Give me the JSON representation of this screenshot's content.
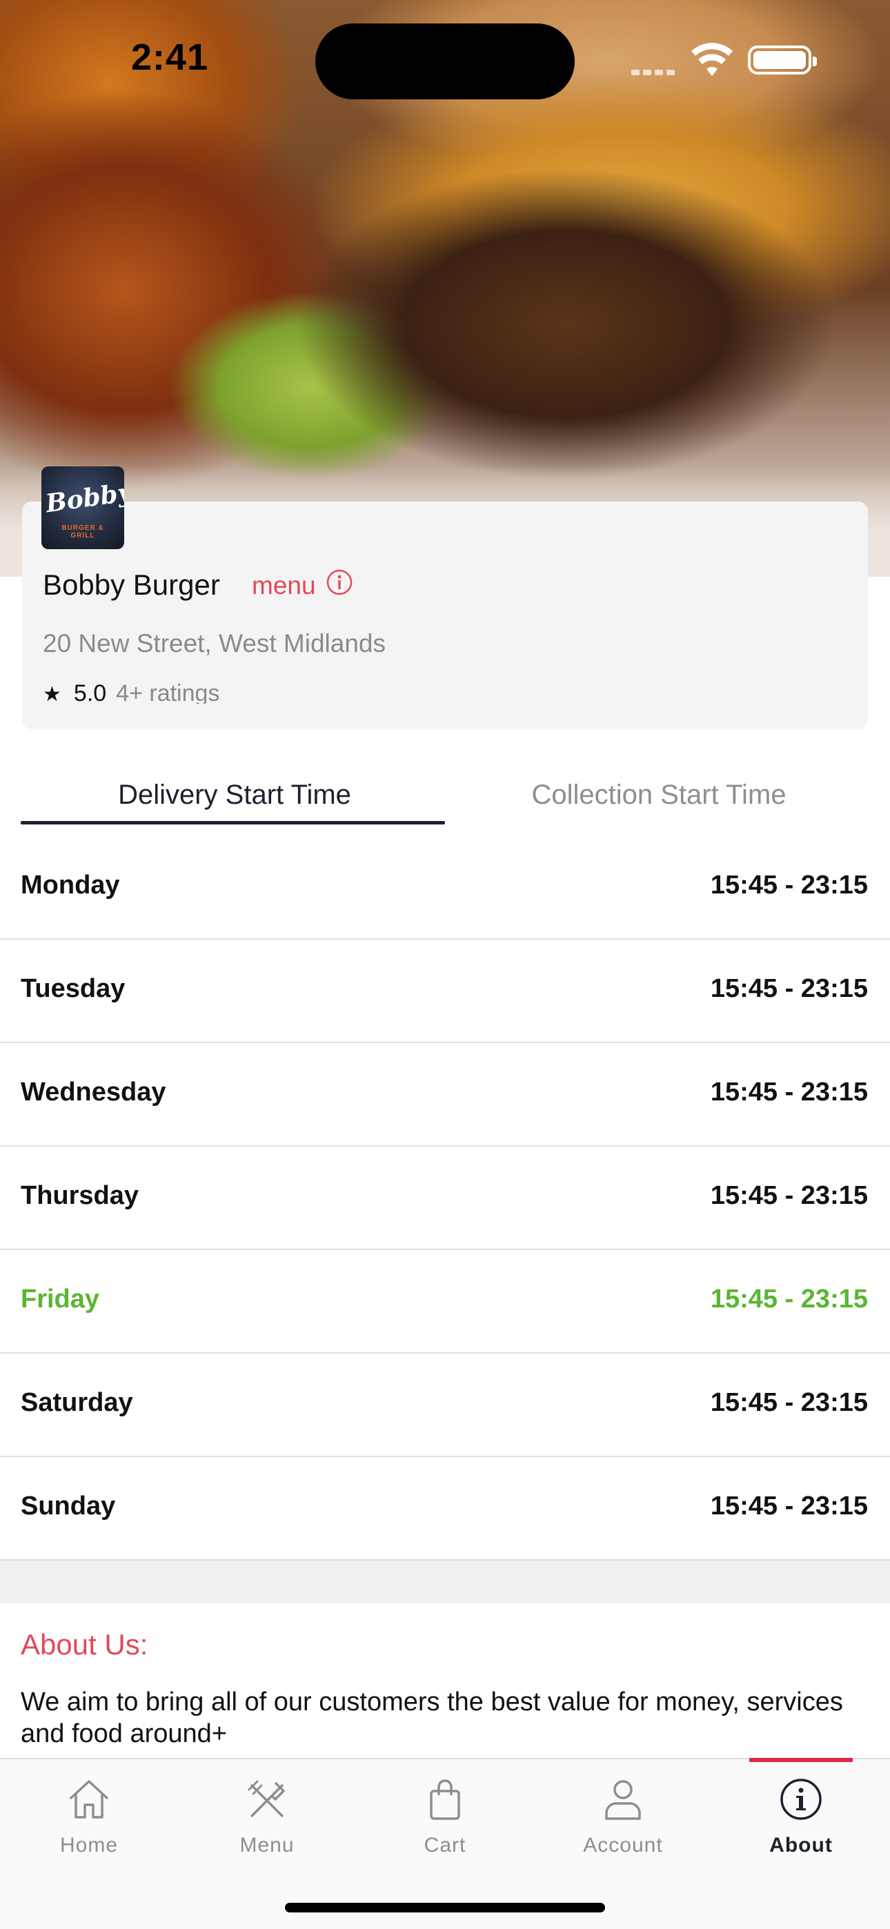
{
  "status_bar": {
    "time": "2:41"
  },
  "restaurant": {
    "logo_text": "Bobby's",
    "logo_subtext": "BURGER & GRILL",
    "name": "Bobby Burger",
    "menu_link": "menu",
    "address": "20 New Street, West Midlands",
    "rating": "5.0",
    "ratings_count": "4+ ratings"
  },
  "tabs": {
    "delivery": "Delivery Start Time",
    "collection": "Collection Start Time",
    "selected": "delivery"
  },
  "hours": [
    {
      "day": "Monday",
      "time": "15:45 - 23:15"
    },
    {
      "day": "Tuesday",
      "time": "15:45 - 23:15"
    },
    {
      "day": "Wednesday",
      "time": "15:45 - 23:15"
    },
    {
      "day": "Thursday",
      "time": "15:45 - 23:15"
    },
    {
      "day": "Friday",
      "time": "15:45 - 23:15",
      "today": true
    },
    {
      "day": "Saturday",
      "time": "15:45 - 23:15"
    },
    {
      "day": "Sunday",
      "time": "15:45 - 23:15"
    }
  ],
  "about": {
    "heading": "About Us:",
    "text": "We aim to bring all of our customers the best value for money, services and food around+"
  },
  "tabbar": {
    "home": "Home",
    "menu": "Menu",
    "cart": "Cart",
    "account": "Account",
    "about": "About",
    "active": "about"
  },
  "colors": {
    "accent_red": "#e04a5a",
    "today_green": "#5cb531",
    "active_tab_bar": "#e0293f",
    "dark_text": "#1c2030"
  },
  "icons": {
    "home": "home-icon",
    "menu": "fork-knife-icon",
    "cart": "shopping-bag-icon",
    "account": "person-icon",
    "about": "info-circle-icon"
  }
}
